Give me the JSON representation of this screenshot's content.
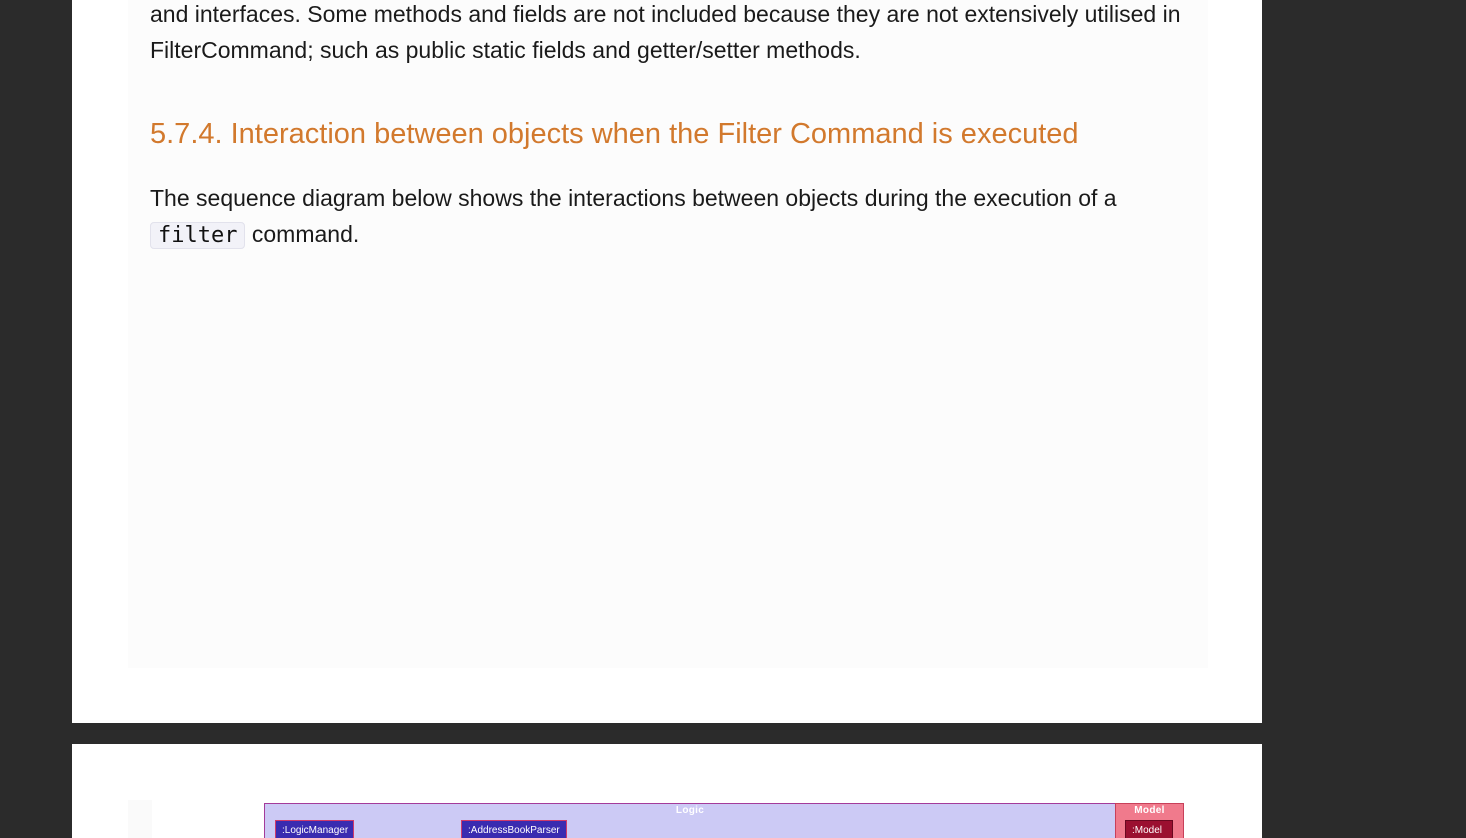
{
  "document": {
    "intro_paragraph": "and interfaces. Some methods and fields are not included because they are not extensively utilised in FilterCommand; such as public static fields and getter/setter methods.",
    "section_heading": "5.7.4. Interaction between objects when the Filter Command is executed",
    "sequence_text_before": "The sequence diagram below shows the interactions between objects during the execution of a ",
    "sequence_code": "filter",
    "sequence_text_after": " command.",
    "heading_color": "#d2792d"
  },
  "diagram": {
    "logic_group_label": "Logic",
    "model_group_label": "Model",
    "participants": [
      ":LogicManager",
      ":AddressBookParser",
      ":Model"
    ],
    "colors": {
      "logic_group": "#cccaf5",
      "model_group": "#f07a8c",
      "logic_participant": "#3a2bb0",
      "model_participant": "#9b1030"
    }
  }
}
